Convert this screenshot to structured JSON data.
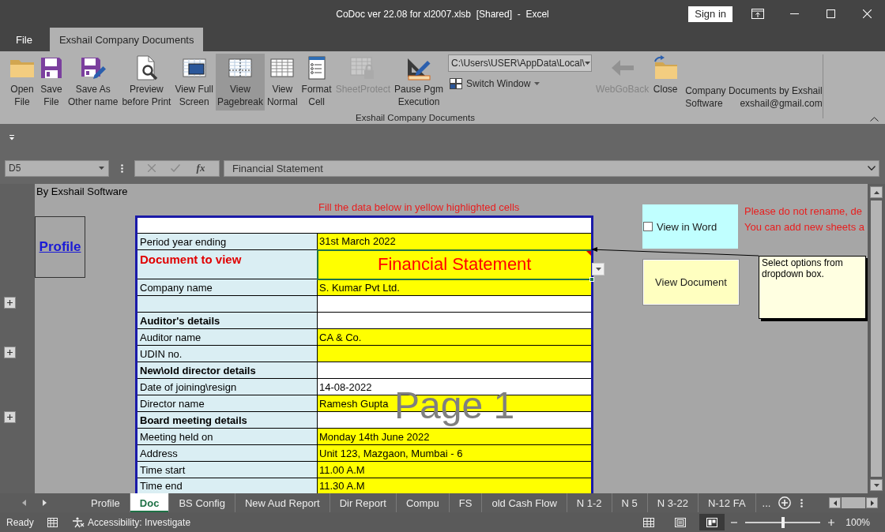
{
  "window": {
    "title": "CoDoc ver 22.08 for xl2007.xlsb  [Shared]  -  Excel",
    "sign_in": "Sign in"
  },
  "ribbon_tabs": [
    {
      "label": "File",
      "selected": false
    },
    {
      "label": "Exshail Company Documents",
      "selected": true
    }
  ],
  "ribbon": {
    "buttons": [
      {
        "lines": [
          "Open",
          "File"
        ],
        "selected": false,
        "disabled": false
      },
      {
        "lines": [
          "Save",
          "File"
        ],
        "selected": false,
        "disabled": false
      },
      {
        "lines": [
          "Save As",
          "Other name"
        ],
        "selected": false,
        "disabled": false
      },
      {
        "lines": [
          "Preview",
          "before Print"
        ],
        "selected": false,
        "disabled": false
      },
      {
        "lines": [
          "View Full",
          "Screen"
        ],
        "selected": false,
        "disabled": false
      },
      {
        "lines": [
          "View",
          "Pagebreak"
        ],
        "selected": true,
        "disabled": false
      },
      {
        "lines": [
          "View",
          "Normal"
        ],
        "selected": false,
        "disabled": false
      },
      {
        "lines": [
          "Format",
          "Cell"
        ],
        "selected": false,
        "disabled": false
      },
      {
        "lines": [
          "SheetProtect"
        ],
        "selected": false,
        "disabled": true
      },
      {
        "lines": [
          "Pause Pgm",
          "Execution"
        ],
        "selected": false,
        "disabled": false
      }
    ],
    "path_box": {
      "value": "C:\\Users\\USER\\AppData\\Local\\"
    },
    "switch_window": "Switch Window",
    "nav_buttons": [
      {
        "lines": [
          "WebGoBack"
        ],
        "selected": false,
        "disabled": true
      },
      {
        "lines": [
          "Close"
        ],
        "selected": false,
        "disabled": false
      }
    ],
    "credit": {
      "line": "Company Documents by Exshail",
      "left": "Software",
      "right": "exshail@gmail.com"
    },
    "group_label": "Exshail Company Documents"
  },
  "formula_bar": {
    "name_box": "D5",
    "function_label": "fx",
    "formula": "Financial Statement"
  },
  "sheet": {
    "header_text": "By Exshail Software",
    "profile_link": "Profile",
    "instruction": "Fill the data below in yellow highlighted cells",
    "rows": [
      {
        "kind": "spacer",
        "highlighted": false,
        "selected": false
      },
      {
        "kind": "field",
        "label": "Period year ending",
        "value": "31st March 2022",
        "highlighted": true,
        "selected": false
      },
      {
        "kind": "title",
        "label": "Document to view",
        "value": "Financial Statement",
        "highlighted": true,
        "selected": true
      },
      {
        "kind": "field",
        "label": "Company name",
        "value": "S. Kumar Pvt Ltd.",
        "highlighted": true,
        "selected": false
      },
      {
        "kind": "field",
        "highlighted": false,
        "selected": false
      },
      {
        "kind": "heading",
        "label": "Auditor's details",
        "highlighted": false,
        "selected": false
      },
      {
        "kind": "field",
        "label": "Auditor name",
        "value": "CA & Co.",
        "highlighted": true,
        "selected": false
      },
      {
        "kind": "field",
        "label": "UDIN no.",
        "highlighted": true,
        "selected": false
      },
      {
        "kind": "heading",
        "label": "New\\old director details",
        "highlighted": false,
        "selected": false
      },
      {
        "kind": "field",
        "label": "Date of joining\\resign",
        "value": "14-08-2022",
        "highlighted": false,
        "selected": false
      },
      {
        "kind": "field",
        "label": "Director name",
        "value": "Ramesh Gupta",
        "highlighted": true,
        "selected": false
      },
      {
        "kind": "heading",
        "label": "Board meeting details",
        "highlighted": false,
        "selected": false
      },
      {
        "kind": "field",
        "label": "Meeting held on",
        "value": "Monday 14th June 2022",
        "highlighted": true,
        "selected": false
      },
      {
        "kind": "field",
        "label": "Address",
        "value": "Unit 123, Mazgaon, Mumbai - 6",
        "highlighted": true,
        "selected": false
      },
      {
        "kind": "field",
        "label": "Time start",
        "value": "11.00 A.M",
        "highlighted": true,
        "selected": false
      },
      {
        "kind": "field",
        "label": "Time end",
        "value": "11.30 A.M",
        "highlighted": true,
        "selected": false
      }
    ],
    "page_label": "Page 1",
    "view_in_word": {
      "label": "View in Word",
      "checked": false
    },
    "view_document": "View Document",
    "notices": [
      "Please do not rename, de",
      "You can add new sheets a"
    ],
    "comment": "Select options from dropdown box."
  },
  "sheet_tabs": [
    {
      "label": "Profile",
      "selected": false
    },
    {
      "label": "Doc",
      "selected": true
    },
    {
      "label": "BS Config",
      "selected": false
    },
    {
      "label": "New Aud Report",
      "selected": false
    },
    {
      "label": "Dir Report",
      "selected": false
    },
    {
      "label": "Compu",
      "selected": false
    },
    {
      "label": "FS",
      "selected": false
    },
    {
      "label": "old Cash Flow",
      "selected": false
    },
    {
      "label": "N 1-2",
      "selected": false
    },
    {
      "label": "N 5",
      "selected": false
    },
    {
      "label": "N 3-22",
      "selected": false
    },
    {
      "label": "N-12 FA",
      "selected": false
    }
  ],
  "more_tabs": "...",
  "status_bar": {
    "status": "Ready",
    "accessibility": "Accessibility: Investigate",
    "views": [
      {
        "selected": false
      },
      {
        "selected": false
      },
      {
        "selected": true
      }
    ],
    "zoom": {
      "level": 0.5,
      "reading": "100%"
    }
  }
}
